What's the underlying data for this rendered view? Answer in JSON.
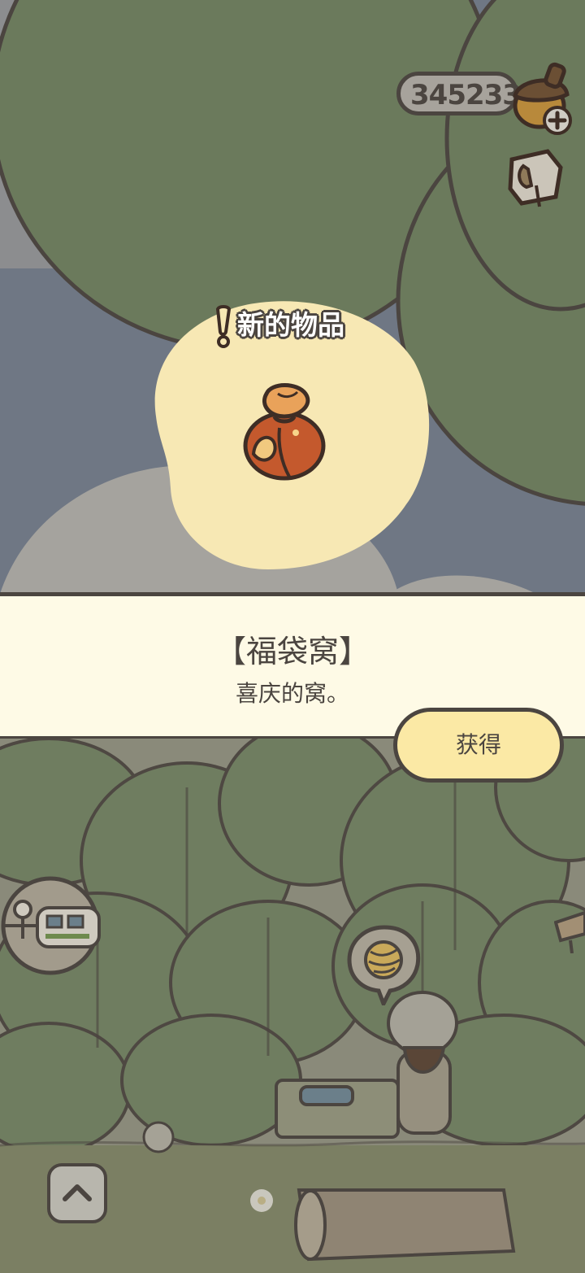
{
  "header": {
    "currency_amount": "345233",
    "currency_icon": "acorn-icon",
    "add_icon": "plus-icon",
    "map_icon": "map-icon"
  },
  "notification": {
    "new_item_label": "新的物品",
    "alert_icon": "exclamation-icon",
    "item_icon": "lucky-bag-icon"
  },
  "item_panel": {
    "title": "【福袋窝】",
    "description": "喜庆的窝。",
    "obtain_button_label": "获得"
  },
  "scene": {
    "train_icon": "train-icon",
    "yarn_icon": "yarn-ball-icon",
    "up_icon": "chevron-up-icon"
  },
  "colors": {
    "panel_bg": "#fefae6",
    "button_bg": "#fbe9a5",
    "outline": "#4b4540",
    "leaf_green": "#6b7a5c",
    "sky": "#6f7784"
  }
}
